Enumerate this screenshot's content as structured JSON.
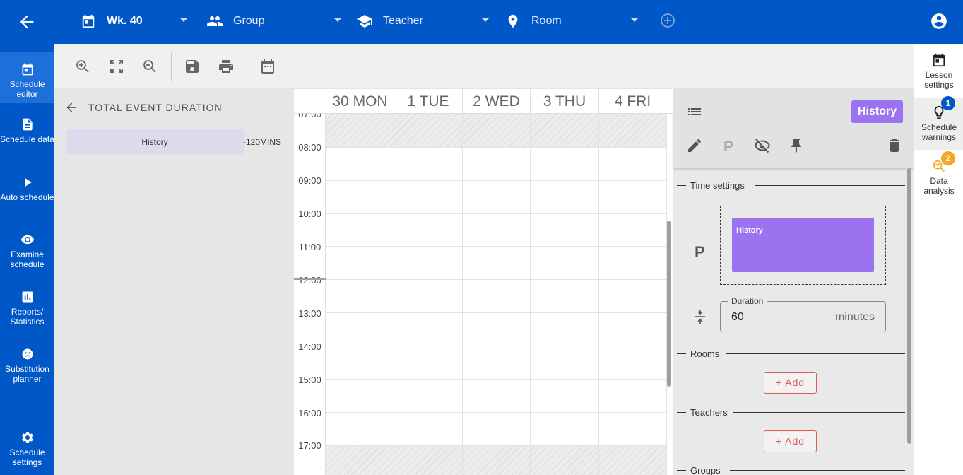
{
  "topbar": {
    "week": "Wk. 40",
    "group": "Group",
    "teacher": "Teacher",
    "room": "Room"
  },
  "nav": {
    "items": [
      {
        "label": "Schedule editor",
        "active": true
      },
      {
        "label": "Schedule data"
      },
      {
        "label": "Auto schedule"
      },
      {
        "label": "Examine schedule"
      },
      {
        "label": "Reports/ Statistics"
      },
      {
        "label": "Substitution planner"
      },
      {
        "label": "Schedule settings"
      }
    ]
  },
  "left_panel": {
    "title": "TOTAL EVENT DURATION",
    "event_name": "History",
    "event_duration": "-120MINS"
  },
  "calendar": {
    "days": [
      "30 MON",
      "1 TUE",
      "2 WED",
      "3 THU",
      "4 FRI"
    ],
    "times": [
      "07:00",
      "08:00",
      "09:00",
      "10:00",
      "11:00",
      "12:00",
      "13:00",
      "14:00",
      "15:00",
      "16:00",
      "17:00"
    ]
  },
  "details": {
    "subject": "History",
    "time_settings_label": "Time settings",
    "period_letter": "P",
    "slot_event": "History",
    "duration_label": "Duration",
    "duration_value": "60",
    "duration_unit": "minutes",
    "rooms_label": "Rooms",
    "teachers_label": "Teachers",
    "groups_label": "Groups",
    "add_label": "+ Add"
  },
  "right_sidebar": {
    "items": [
      {
        "label": "Lesson settings"
      },
      {
        "label": "Schedule warnings",
        "badge": "1"
      },
      {
        "label": "Data analysis",
        "badge": "2"
      }
    ]
  },
  "colors": {
    "primary": "#0057c8",
    "event": "#9b72f0",
    "add_button": "#e05a5a",
    "badge_blue": "#0057c8",
    "badge_orange": "#f5a623"
  }
}
